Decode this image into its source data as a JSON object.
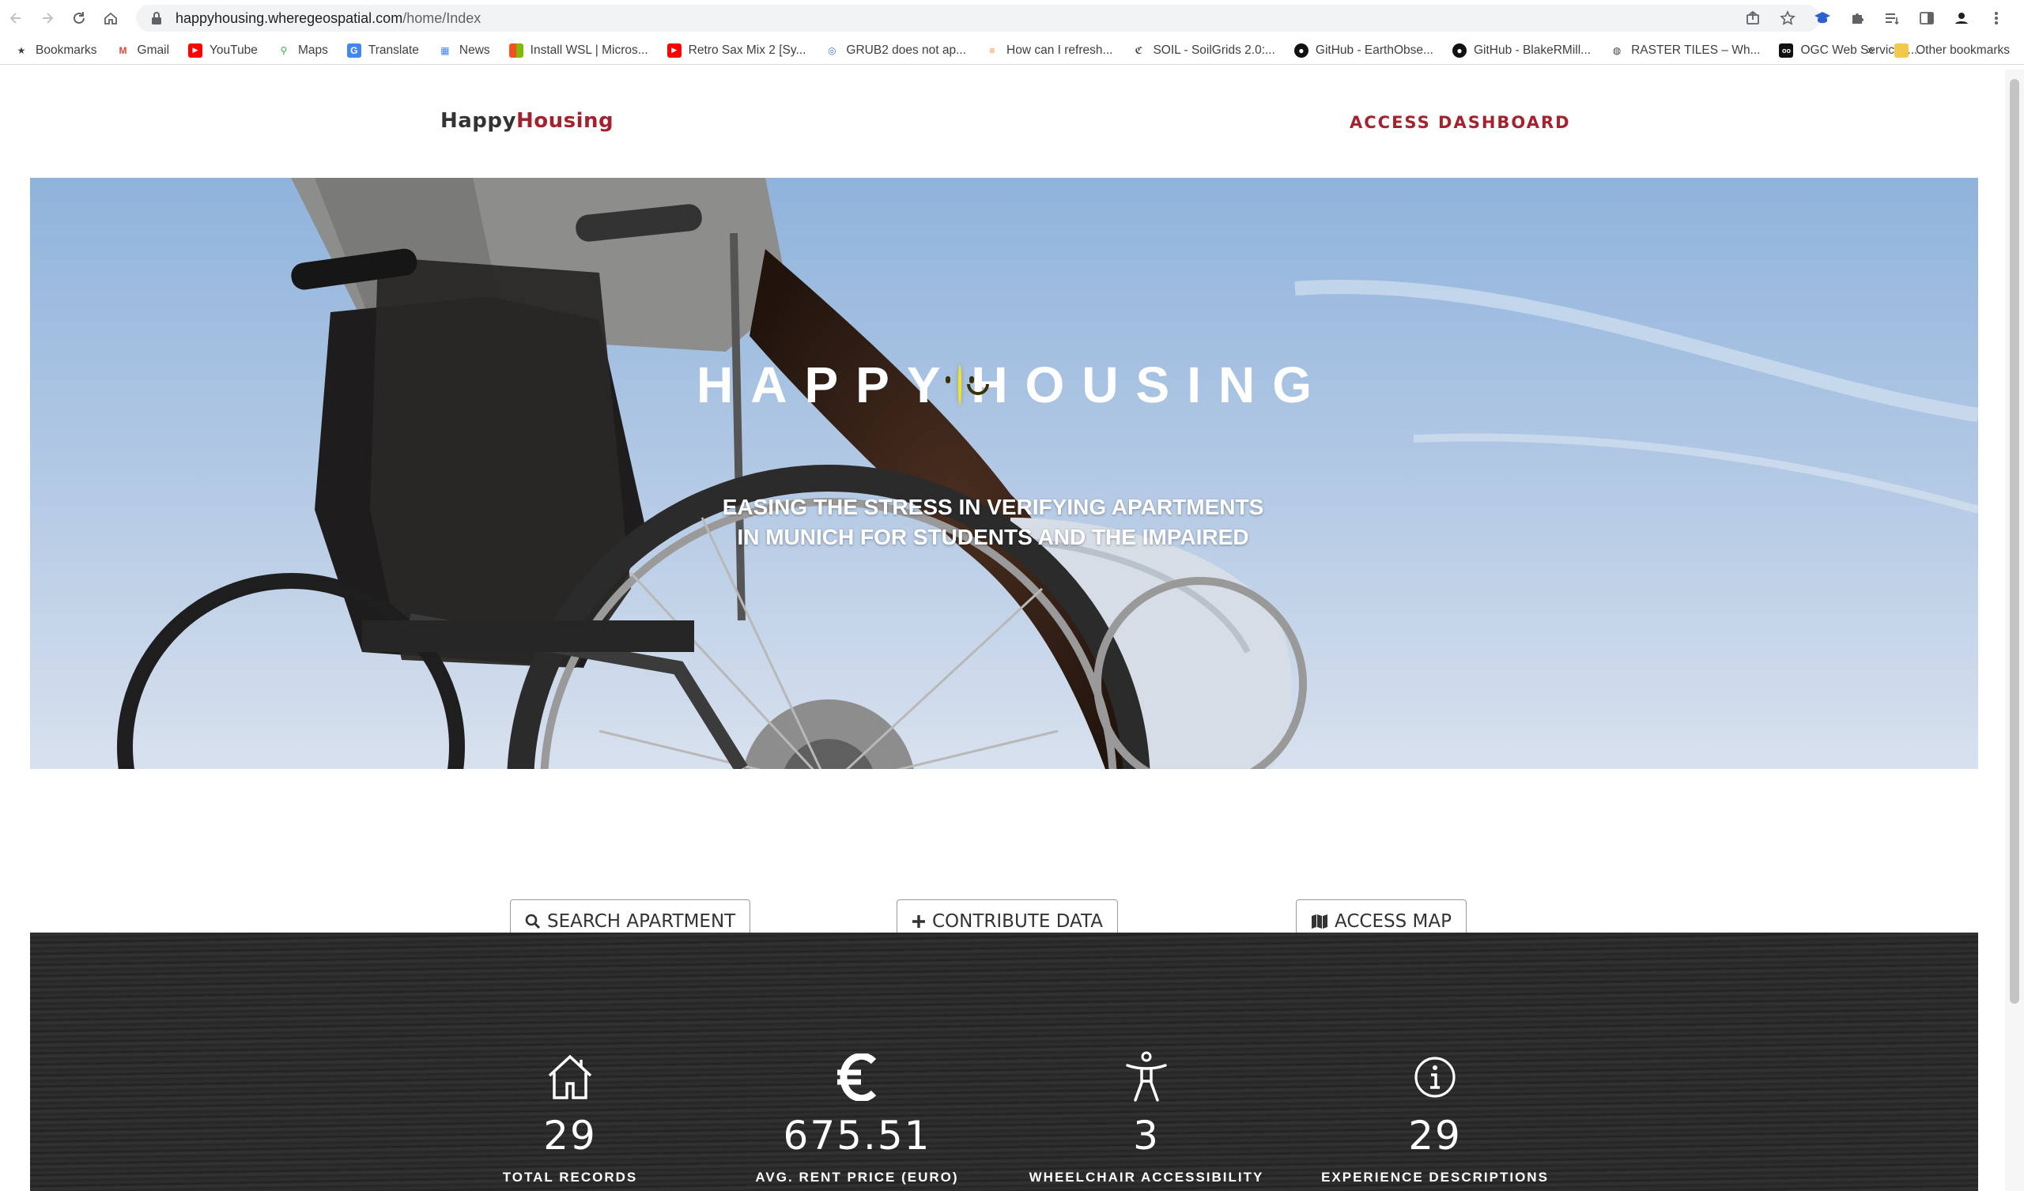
{
  "browser": {
    "url_host": "happyhousing.wheregeospatial.com",
    "url_path": "/home/Index",
    "bookmarks": [
      {
        "label": "Bookmarks",
        "icon": "star-icon"
      },
      {
        "label": "Gmail",
        "icon": "gmail-icon"
      },
      {
        "label": "YouTube",
        "icon": "youtube-icon"
      },
      {
        "label": "Maps",
        "icon": "maps-icon"
      },
      {
        "label": "Translate",
        "icon": "translate-icon"
      },
      {
        "label": "News",
        "icon": "news-icon"
      },
      {
        "label": "Install WSL | Micros...",
        "icon": "microsoft-icon"
      },
      {
        "label": "Retro Sax Mix 2 [Sy...",
        "icon": "youtube-icon"
      },
      {
        "label": "GRUB2 does not ap...",
        "icon": "askubuntu-icon"
      },
      {
        "label": "How can I refresh...",
        "icon": "stackoverflow-icon"
      },
      {
        "label": "SOIL - SoilGrids 2.0:...",
        "icon": "soil-icon"
      },
      {
        "label": "GitHub - EarthObse...",
        "icon": "github-icon"
      },
      {
        "label": "GitHub - BlakeRMill...",
        "icon": "github-icon"
      },
      {
        "label": "RASTER TILES – Wh...",
        "icon": "globe-icon"
      },
      {
        "label": "OGC Web Services....",
        "icon": "ogc-icon"
      }
    ],
    "more_label": "»",
    "other_bookmarks": "Other bookmarks"
  },
  "header": {
    "logo_part1": "Happy",
    "logo_part2": "Housing",
    "dashboard_link": "ACCESS DASHBOARD"
  },
  "hero": {
    "title_left": "HAPPY",
    "title_right": "HOUSING",
    "subtitle": "EASING THE STRESS IN VERIFYING APARTMENTS IN MUNICH FOR STUDENTS AND THE IMPAIRED",
    "slide_count": 3,
    "active_slide": 1
  },
  "actions": {
    "search": "SEARCH APARTMENT",
    "contribute": "CONTRIBUTE DATA",
    "map": "ACCESS MAP"
  },
  "stats": [
    {
      "icon": "house-icon",
      "value": "29",
      "label": "TOTAL RECORDS"
    },
    {
      "icon": "euro-icon",
      "value": "675.51",
      "label": "AVG. RENT PRICE (EURO)"
    },
    {
      "icon": "accessibility-icon",
      "value": "3",
      "label": "WHEELCHAIR ACCESSIBILITY"
    },
    {
      "icon": "info-icon",
      "value": "29",
      "label": "EXPERIENCE DESCRIPTIONS"
    }
  ],
  "colors": {
    "brand_red": "#a4222e",
    "smiley_yellow": "#f6e421"
  }
}
